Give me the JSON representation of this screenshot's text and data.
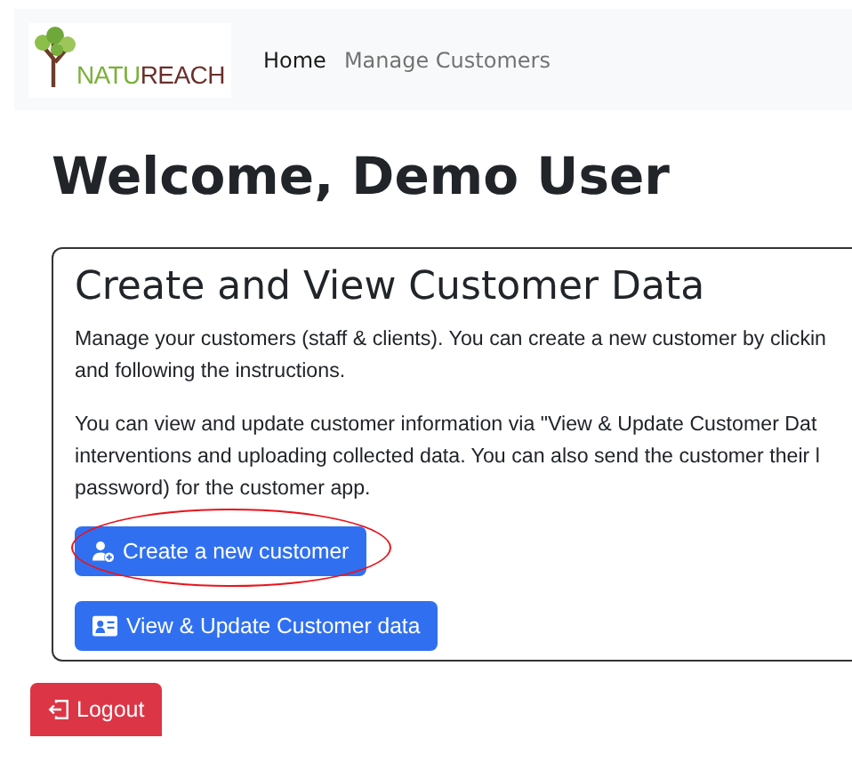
{
  "navbar": {
    "logo": {
      "text_parts": [
        "NATU",
        "REACH"
      ]
    },
    "links": [
      {
        "label": "Home",
        "selected": true
      },
      {
        "label": "Manage Customers",
        "selected": false
      }
    ]
  },
  "heading": "Welcome, Demo User",
  "card": {
    "title": "Create and View Customer Data",
    "paragraphs": [
      [
        "Manage your customers (staff & clients). You can create a new customer by clickin",
        "and following the instructions."
      ],
      [
        "You can view and update customer information via \"View & Update Customer Dat",
        "interventions and uploading collected data. You can also send the customer their l",
        "password) for the customer app."
      ]
    ],
    "buttons": [
      {
        "kind": "add-person",
        "label": "Create a new customer",
        "highlighted": true
      },
      {
        "kind": "id-card",
        "label": "View & Update Customer data",
        "highlighted": false
      }
    ]
  },
  "logout": {
    "label": "Logout"
  }
}
